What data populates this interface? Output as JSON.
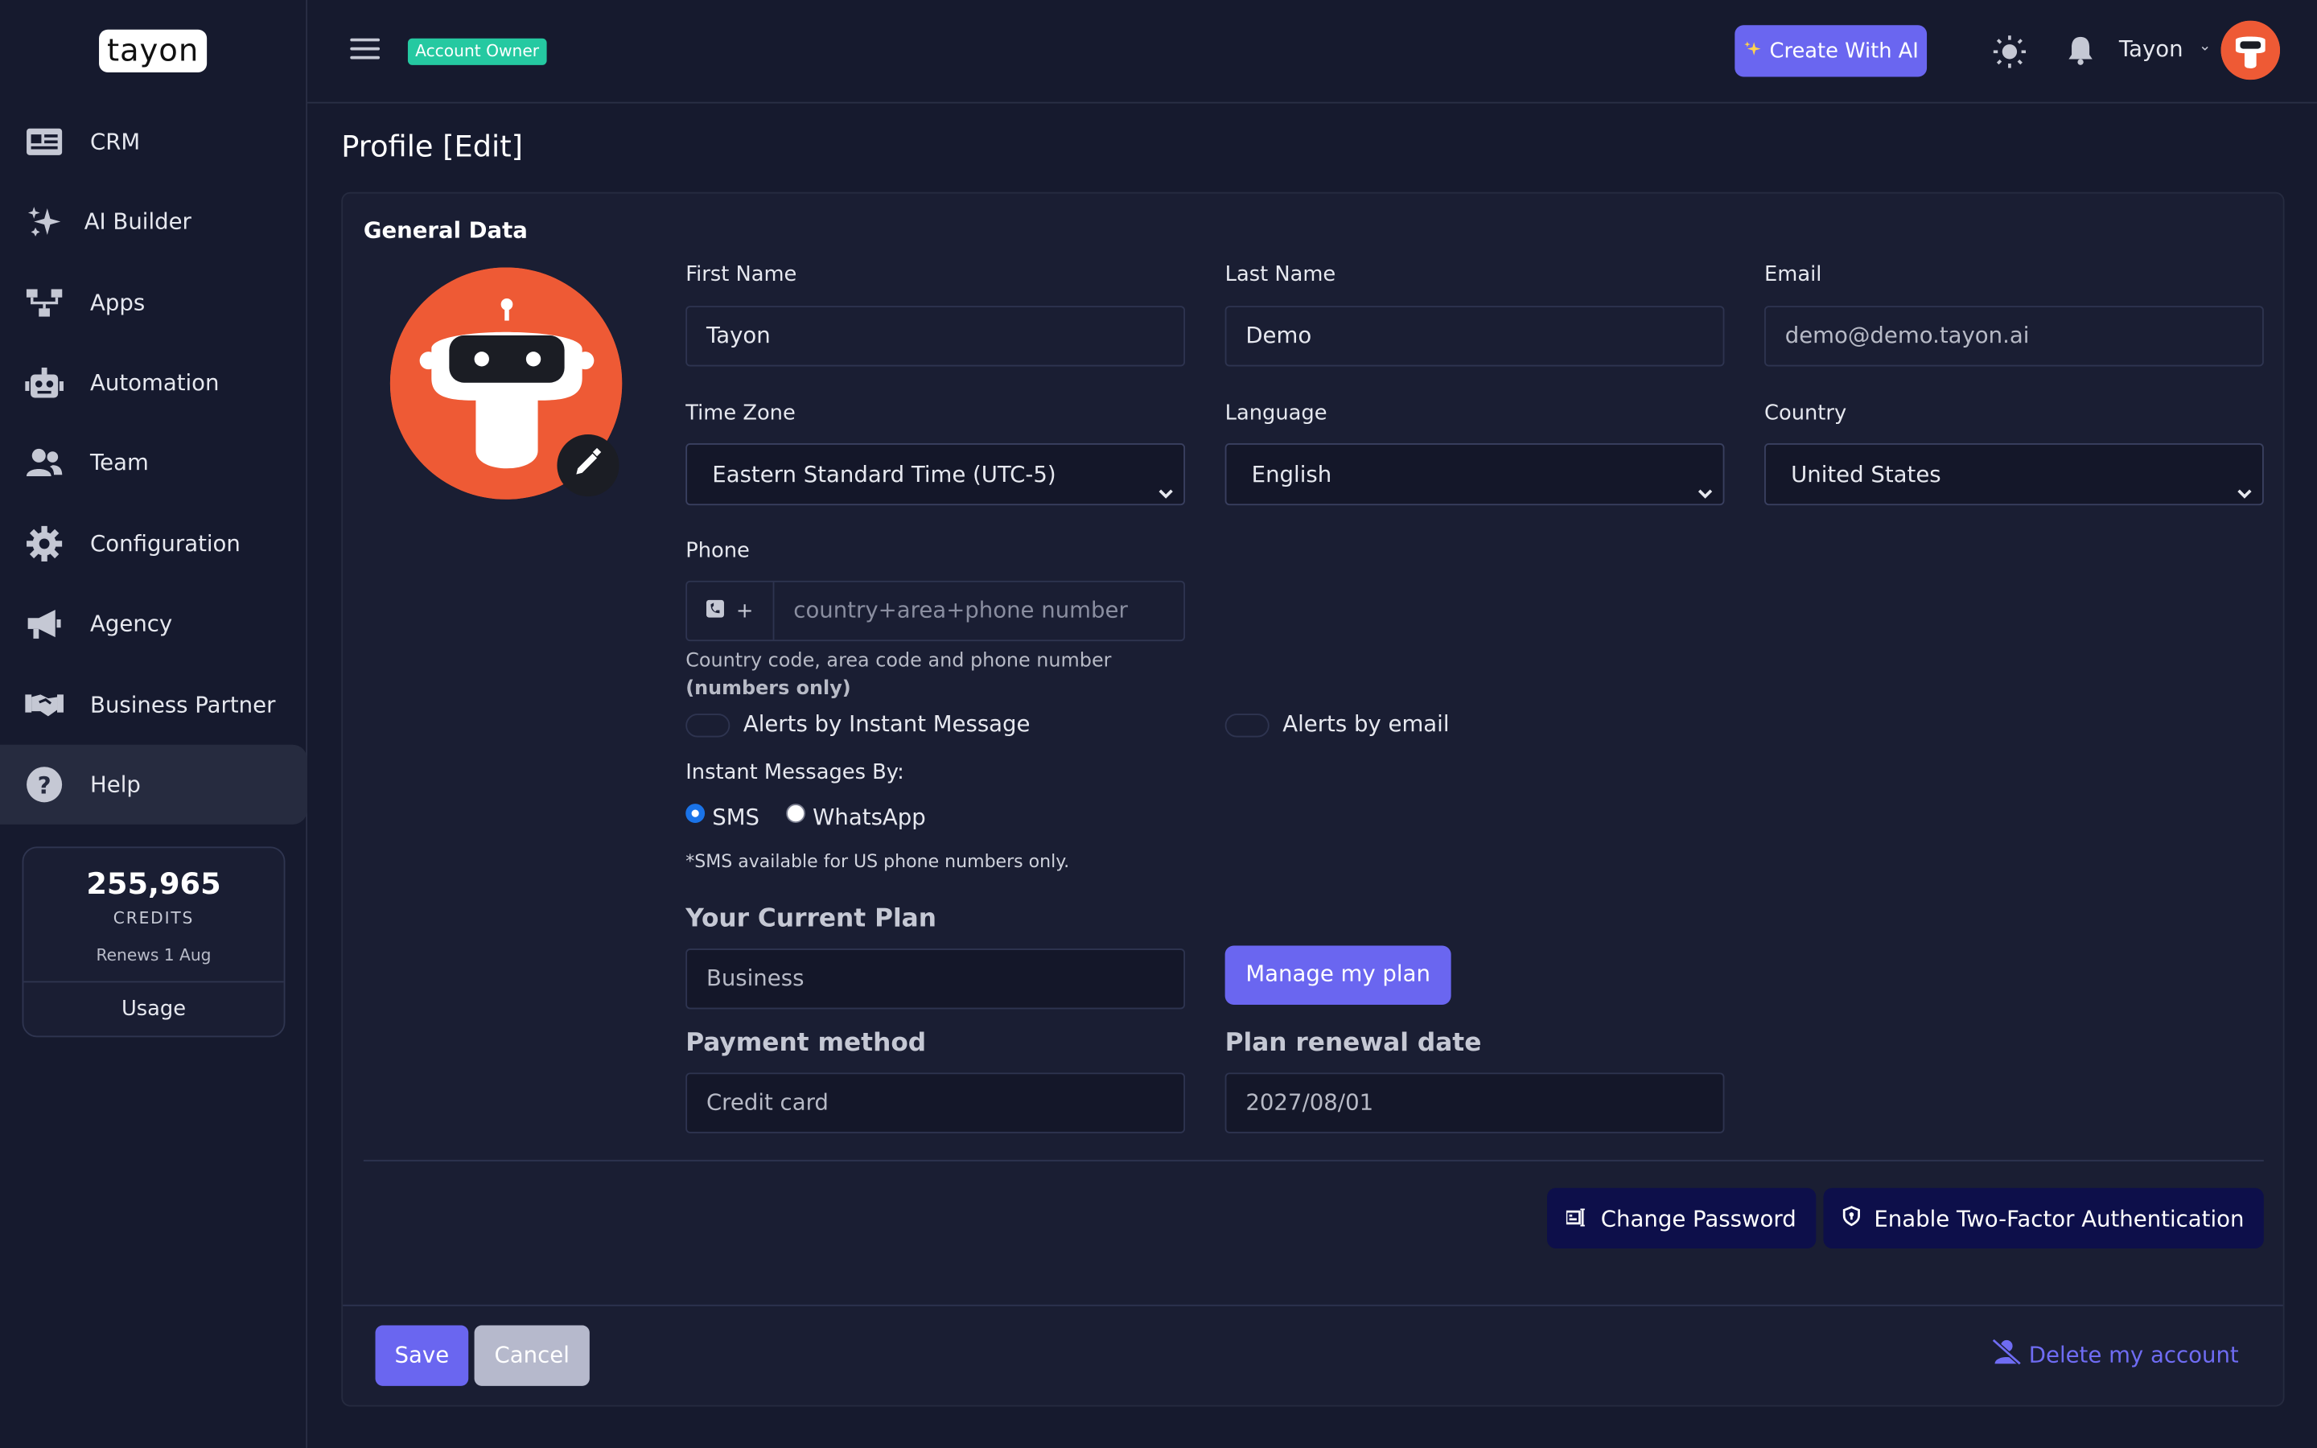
{
  "app": {
    "logo_text": "tayon"
  },
  "sidebar": {
    "items": [
      {
        "label": "CRM",
        "icon": "id-card-icon"
      },
      {
        "label": "AI Builder",
        "icon": "sparkles-icon"
      },
      {
        "label": "Apps",
        "icon": "sitemap-icon"
      },
      {
        "label": "Automation",
        "icon": "robot-icon"
      },
      {
        "label": "Team",
        "icon": "users-icon"
      },
      {
        "label": "Configuration",
        "icon": "gear-icon"
      },
      {
        "label": "Agency",
        "icon": "megaphone-icon"
      },
      {
        "label": "Business Partner",
        "icon": "handshake-icon"
      },
      {
        "label": "Help",
        "icon": "question-circle-icon",
        "active": true
      }
    ],
    "credits": {
      "amount": "255,965",
      "label": "CREDITS",
      "renews": "Renews 1 Aug",
      "usage_label": "Usage"
    }
  },
  "header": {
    "role_badge": "Account Owner",
    "create_ai_label": "Create With AI",
    "user_name": "Tayon"
  },
  "page": {
    "title": "Profile [Edit]"
  },
  "general": {
    "section_title": "General Data",
    "first_name": {
      "label": "First Name",
      "value": "Tayon"
    },
    "last_name": {
      "label": "Last Name",
      "value": "Demo"
    },
    "email": {
      "label": "Email",
      "value": "demo@demo.tayon.ai"
    },
    "time_zone": {
      "label": "Time Zone",
      "value": "Eastern Standard Time (UTC-5)"
    },
    "language": {
      "label": "Language",
      "value": "English"
    },
    "country": {
      "label": "Country",
      "value": "United States"
    },
    "phone": {
      "label": "Phone",
      "prefix": "+",
      "placeholder": "country+area+phone number",
      "hint": "Country code, area code and phone number",
      "hint_bold": "(numbers only)"
    },
    "alerts_im_label": "Alerts by Instant Message",
    "alerts_email_label": "Alerts by email",
    "im_by_label": "Instant Messages By:",
    "im_options": [
      {
        "label": "SMS",
        "selected": true
      },
      {
        "label": "WhatsApp",
        "selected": false
      }
    ],
    "sms_note": "*SMS available for US phone numbers only."
  },
  "plan": {
    "current_plan_label": "Your Current Plan",
    "current_plan_value": "Business",
    "manage_label": "Manage my plan",
    "payment_label": "Payment method",
    "payment_value": "Credit card",
    "renewal_label": "Plan renewal date",
    "renewal_value": "2027/08/01"
  },
  "security": {
    "change_password_label": "Change Password",
    "two_factor_label": "Enable Two-Factor Authentication"
  },
  "footer": {
    "save_label": "Save",
    "cancel_label": "Cancel",
    "delete_label": "Delete my account"
  },
  "colors": {
    "background": "#161a2e",
    "card": "#1a1e33",
    "accent": "#6a66f0",
    "badge": "#25c9a1",
    "avatar": "#ee5a35",
    "navy_button": "#0d0f4a"
  }
}
